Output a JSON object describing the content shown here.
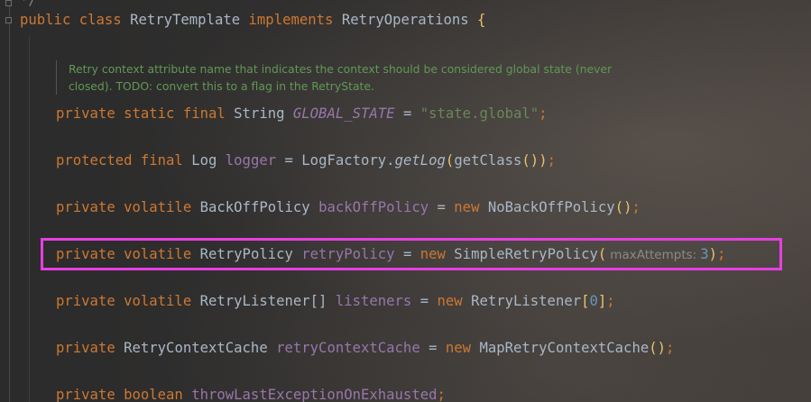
{
  "top_comment": "*/",
  "class_decl": {
    "kw_public": "public",
    "kw_class": "class",
    "class_name": "RetryTemplate",
    "kw_implements": "implements",
    "interface_name": "RetryOperations",
    "open_brace": "{"
  },
  "doc_comment": {
    "line1": "Retry context attribute name that indicates the context should be considered global state (never",
    "line2": "closed). TODO: convert this to a flag in the RetryState."
  },
  "fields": {
    "global_state": {
      "mods": "private static final",
      "type": "String",
      "name": "GLOBAL_STATE",
      "eq": "=",
      "value": "\"state.global\"",
      "semi": ";"
    },
    "logger": {
      "mods": "protected final",
      "type": "Log",
      "name": "logger",
      "eq": "= LogFactory.",
      "method": "getLog",
      "open": "(",
      "call": "getClass",
      "inner_parens": "()",
      "close": ")",
      "semi": ";"
    },
    "backoff": {
      "mods": "private volatile",
      "type": "BackOffPolicy",
      "name": "backOffPolicy",
      "eq": "=",
      "kw_new": "new",
      "ctor": "NoBackOffPolicy",
      "parens": "()",
      "semi": ";"
    },
    "retry_policy": {
      "mods": "private volatile",
      "type": "RetryPolicy",
      "name": "retryPolicy",
      "eq": "=",
      "kw_new": "new",
      "ctor": "SimpleRetryPolicy",
      "open": "(",
      "hint": "maxAttempts:",
      "arg": "3",
      "close": ")",
      "semi": ";"
    },
    "listeners": {
      "mods": "private volatile",
      "type": "RetryListener[]",
      "name": "listeners",
      "eq": "=",
      "kw_new": "new",
      "ctor": "RetryListener",
      "open": "[",
      "arg": "0",
      "close": "]",
      "semi": ";"
    },
    "context_cache": {
      "mods": "private",
      "type": "RetryContextCache",
      "name": "retryContextCache",
      "eq": "=",
      "kw_new": "new",
      "ctor": "MapRetryContextCache",
      "parens": "()",
      "semi": ";"
    },
    "throw_last": {
      "mods": "private boolean",
      "name": "throwLastExceptionOnExhausted",
      "semi": ";"
    }
  },
  "colors": {
    "keyword": "#cc7832",
    "field": "#9876aa",
    "string": "#6a8759",
    "number": "#6897bb",
    "doc": "#629755",
    "highlight": "#e83ee3"
  }
}
